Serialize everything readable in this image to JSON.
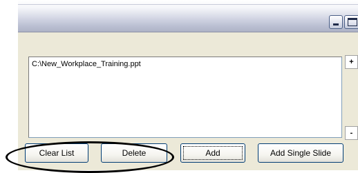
{
  "list": {
    "items": [
      "C:\\New_Workplace_Training.ppt"
    ],
    "add_symbol": "+",
    "remove_symbol": "-"
  },
  "buttons": {
    "clear_list": "Clear List",
    "delete": "Delete",
    "add": "Add",
    "add_single_slide": "Add Single Slide"
  },
  "title_bar": {
    "minimize_icon": "minimize-icon",
    "maximize_icon": "maximize-icon"
  },
  "colors": {
    "window_bg": "#ece9d8",
    "button_border": "#003c74",
    "annotation": "#000000"
  }
}
